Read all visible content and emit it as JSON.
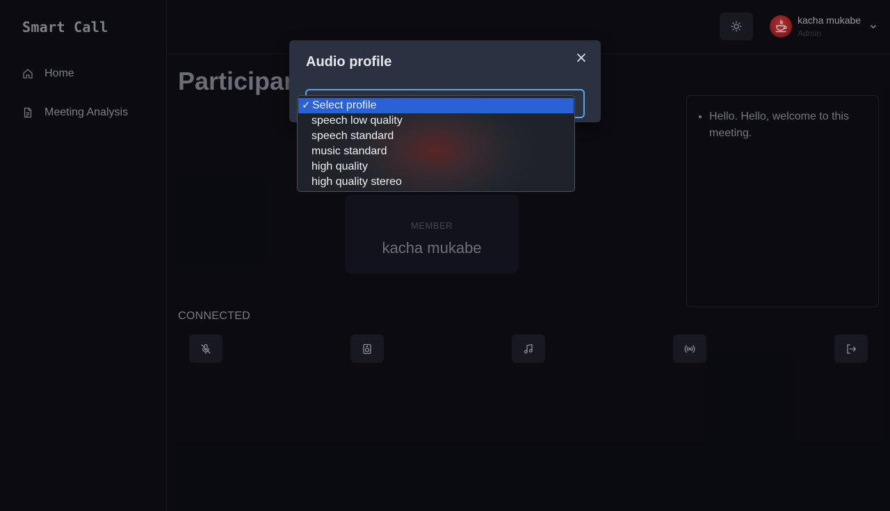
{
  "app": {
    "brand": "Smart Call"
  },
  "sidebar": {
    "items": [
      {
        "label": "Home",
        "icon": "home-icon"
      },
      {
        "label": "Meeting Analysis",
        "icon": "document-icon"
      }
    ]
  },
  "header": {
    "user_name": "kacha mukabe",
    "user_role": "Admin"
  },
  "main": {
    "title": "Participants",
    "member_role": "MEMBER",
    "member_name": "kacha mukabe",
    "transcript": [
      "Hello. Hello, welcome to this meeting."
    ],
    "status": "CONNECTED",
    "controls": [
      "mic-off-icon",
      "speaker-icon",
      "music-note-icon",
      "broadcast-icon",
      "exit-icon"
    ]
  },
  "modal": {
    "title": "Audio profile",
    "select": {
      "selected": "Select profile",
      "options": [
        "Select profile",
        "speech low quality",
        "speech standard",
        "music standard",
        "high quality",
        "high quality stereo"
      ]
    }
  },
  "colors": {
    "accent": "#2a62d6",
    "focus_ring": "#5fa2e6",
    "background": "#0c0d13",
    "modal_bg": "#2a3140"
  }
}
